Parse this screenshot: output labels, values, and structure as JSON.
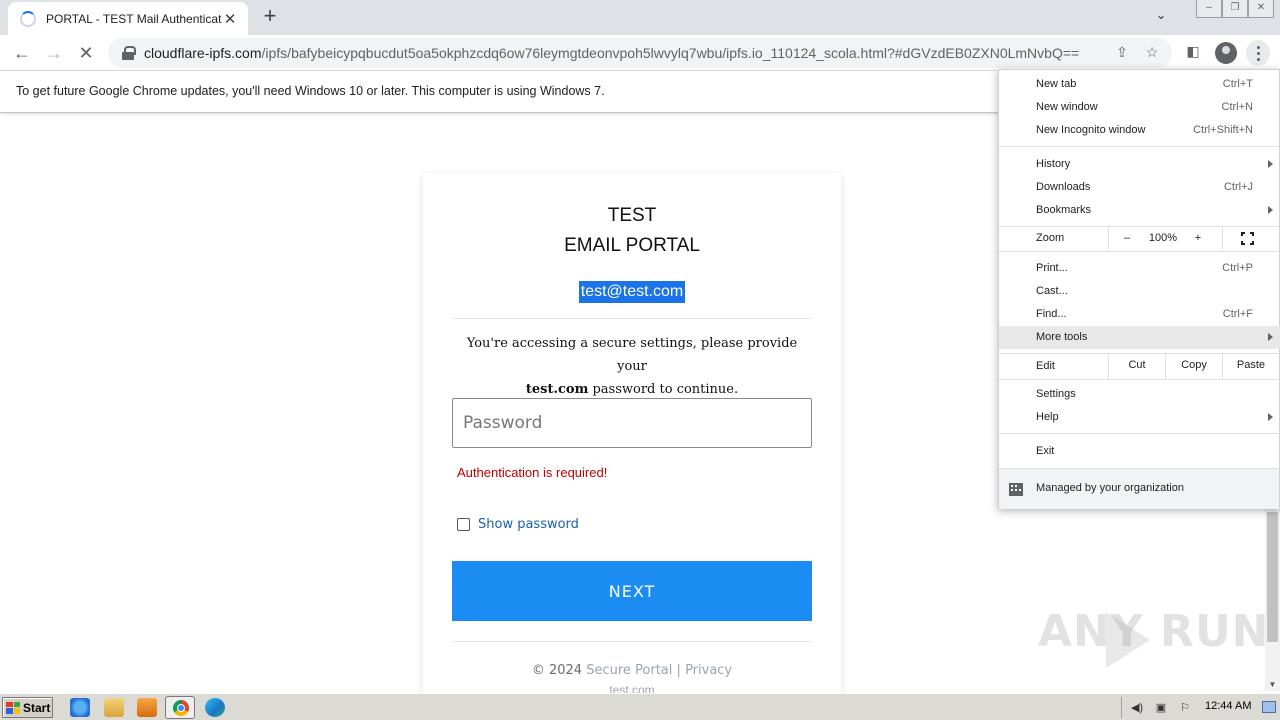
{
  "browser": {
    "tab_title": "PORTAL - TEST Mail Authentication",
    "tab_close": "✕",
    "new_tab": "+",
    "url_host": "cloudflare-ipfs.com",
    "url_path": "/ipfs/bafybeicypqbucdut5oa5okphzcdq6ow76leymgtdeonvpoh5lwvylq7wbu/ipfs.io_110124_scola.html?#dGVzdEB0ZXN0LmNvbQ==",
    "infobar_text": "To get future Google Chrome updates, you'll need Windows 10 or later. This computer is using Windows 7."
  },
  "page": {
    "brand_line1": "TEST",
    "brand_line2": "EMAIL PORTAL",
    "email": "test@test.com",
    "notice_before": "You're accessing a secure settings, please provide your",
    "notice_domain": "test.com",
    "notice_after": "password to continue.",
    "password_placeholder": "Password",
    "error": "Authentication is required!",
    "show_password": "Show password",
    "next_button": "NEXT",
    "footer_copyright": "© 2024",
    "footer_link1": "Secure Portal",
    "footer_sep": "|",
    "footer_link2": "Privacy",
    "footer_domain": "test.com",
    "button_color": "#1b8cf2",
    "error_color": "#c00000"
  },
  "menu": {
    "new_tab": "New tab",
    "new_tab_sc": "Ctrl+T",
    "new_window": "New window",
    "new_window_sc": "Ctrl+N",
    "incognito": "New Incognito window",
    "incognito_sc": "Ctrl+Shift+N",
    "history": "History",
    "downloads": "Downloads",
    "downloads_sc": "Ctrl+J",
    "bookmarks": "Bookmarks",
    "zoom": "Zoom",
    "zoom_minus": "–",
    "zoom_value": "100%",
    "zoom_plus": "+",
    "print": "Print...",
    "print_sc": "Ctrl+P",
    "cast": "Cast...",
    "find": "Find...",
    "find_sc": "Ctrl+F",
    "more_tools": "More tools",
    "edit": "Edit",
    "cut": "Cut",
    "copy": "Copy",
    "paste": "Paste",
    "settings": "Settings",
    "help": "Help",
    "exit": "Exit",
    "managed": "Managed by your organization"
  },
  "watermark": "ANY RUN",
  "taskbar": {
    "start": "Start",
    "clock": "12:44 AM"
  }
}
